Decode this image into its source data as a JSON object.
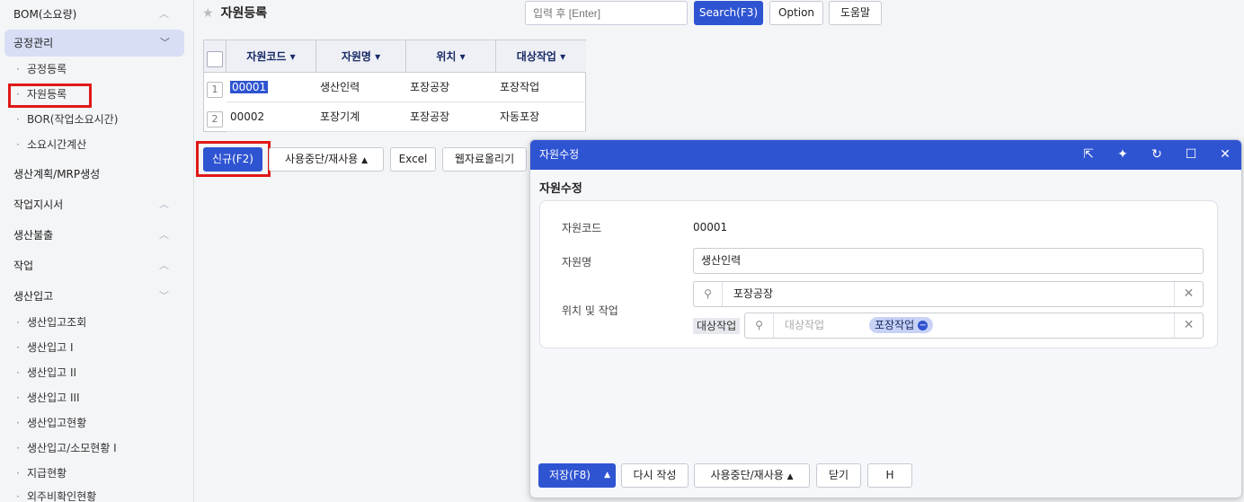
{
  "sidebar": {
    "groups": [
      {
        "label": "BOM(소요량)"
      },
      {
        "label": "공정관리"
      },
      {
        "label": "생산계획/MRP생성"
      },
      {
        "label": "작업지시서"
      },
      {
        "label": "생산불출"
      },
      {
        "label": "작업"
      },
      {
        "label": "생산입고"
      }
    ],
    "process_items": [
      "공정등록",
      "자원등록",
      "BOR(작업소요시간)",
      "소요시간계산"
    ],
    "production_items": [
      "생산입고조회",
      "생산입고 I",
      "생산입고 II",
      "생산입고 III",
      "생산입고현황",
      "생산입고/소모현황 I",
      "지급현황",
      "외주비확인현황"
    ]
  },
  "header": {
    "title": "자원등록",
    "search_placeholder": "입력 후 [Enter]",
    "search_button": "Search(F3)",
    "option_button": "Option",
    "help_button": "도움말"
  },
  "grid": {
    "columns": [
      "자원코드",
      "자원명",
      "위치",
      "대상작업"
    ],
    "rows": [
      {
        "num": "1",
        "code": "00001",
        "name": "생산인력",
        "location": "포장공장",
        "task": "포장작업"
      },
      {
        "num": "2",
        "code": "00002",
        "name": "포장기계",
        "location": "포장공장",
        "task": "자동포장"
      }
    ]
  },
  "toolbar": {
    "new_button": "신규(F2)",
    "toggle_use": "사용중단/재사용",
    "excel": "Excel",
    "web_upload": "웹자료올리기"
  },
  "modal": {
    "title": "자원수정",
    "subtitle": "자원수정",
    "fields": {
      "code_label": "자원코드",
      "code_value": "00001",
      "name_label": "자원명",
      "name_value": "생산인력",
      "loc_label": "위치 및 작업",
      "location_value": "포장공장",
      "task_prefix": "대상작업",
      "task_placeholder": "대상작업",
      "task_tag": "포장작업"
    },
    "footer": {
      "save": "저장(F8)",
      "rewrite": "다시 작성",
      "toggle_use": "사용중단/재사용",
      "close": "닫기",
      "h": "H"
    }
  },
  "colors": {
    "accent": "#2f54d2",
    "highlight": "#e01818"
  }
}
